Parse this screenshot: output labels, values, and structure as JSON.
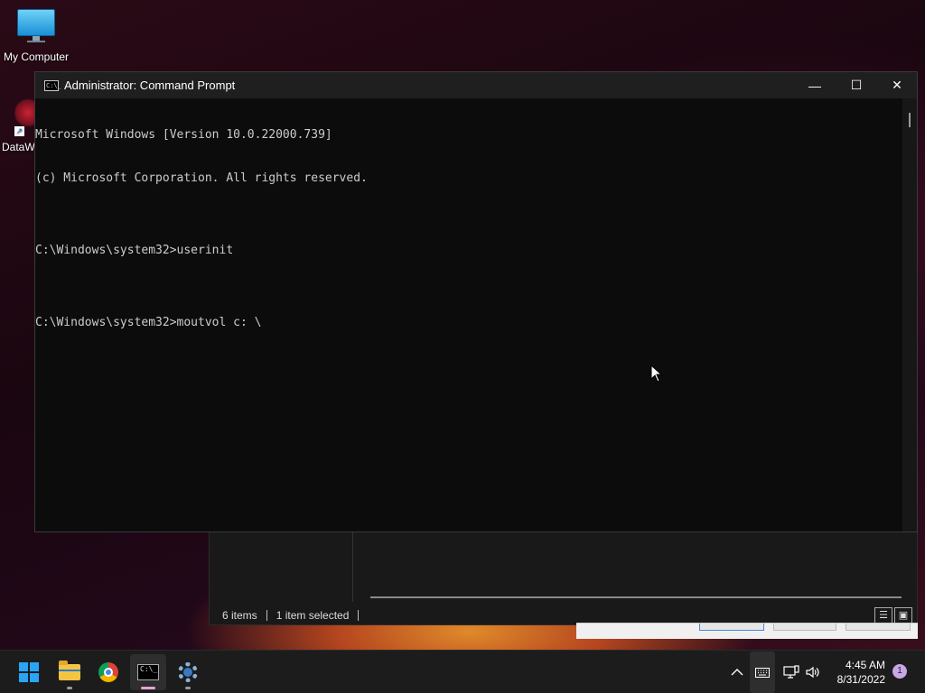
{
  "desktop": {
    "icons": [
      {
        "label": "My Computer"
      },
      {
        "label": "DataW"
      }
    ]
  },
  "explorer": {
    "status_items": "6 items",
    "status_selected": "1 item selected"
  },
  "cmd_window": {
    "title": "Administrator: Command Prompt",
    "icon_text": "C:\\_",
    "controls": {
      "minimize": "—",
      "maximize": "☐",
      "close": "✕"
    },
    "console_lines": [
      "Microsoft Windows [Version 10.0.22000.739]",
      "(c) Microsoft Corporation. All rights reserved.",
      "",
      "C:\\Windows\\system32>userinit",
      "",
      "C:\\Windows\\system32>moutvol c: \\"
    ]
  },
  "taskbar": {
    "apps": [
      {
        "name": "start-button",
        "icon": "windows-logo-icon"
      },
      {
        "name": "file-explorer",
        "icon": "folder-icon"
      },
      {
        "name": "chrome",
        "icon": "chrome-icon"
      },
      {
        "name": "command-prompt",
        "icon": "terminal-icon",
        "active": true
      },
      {
        "name": "settings",
        "icon": "gear-icon"
      }
    ],
    "tray": {
      "overflow_chevron": "^",
      "time": "4:45 AM",
      "date": "8/31/2022",
      "notification_count": "1"
    }
  },
  "colors": {
    "console_bg": "#0c0c0c",
    "console_text": "#cccccc",
    "titlebar_bg": "#1f1f1f",
    "taskbar_bg": "#1c1c1c",
    "active_indicator": "#e6a3d8"
  }
}
